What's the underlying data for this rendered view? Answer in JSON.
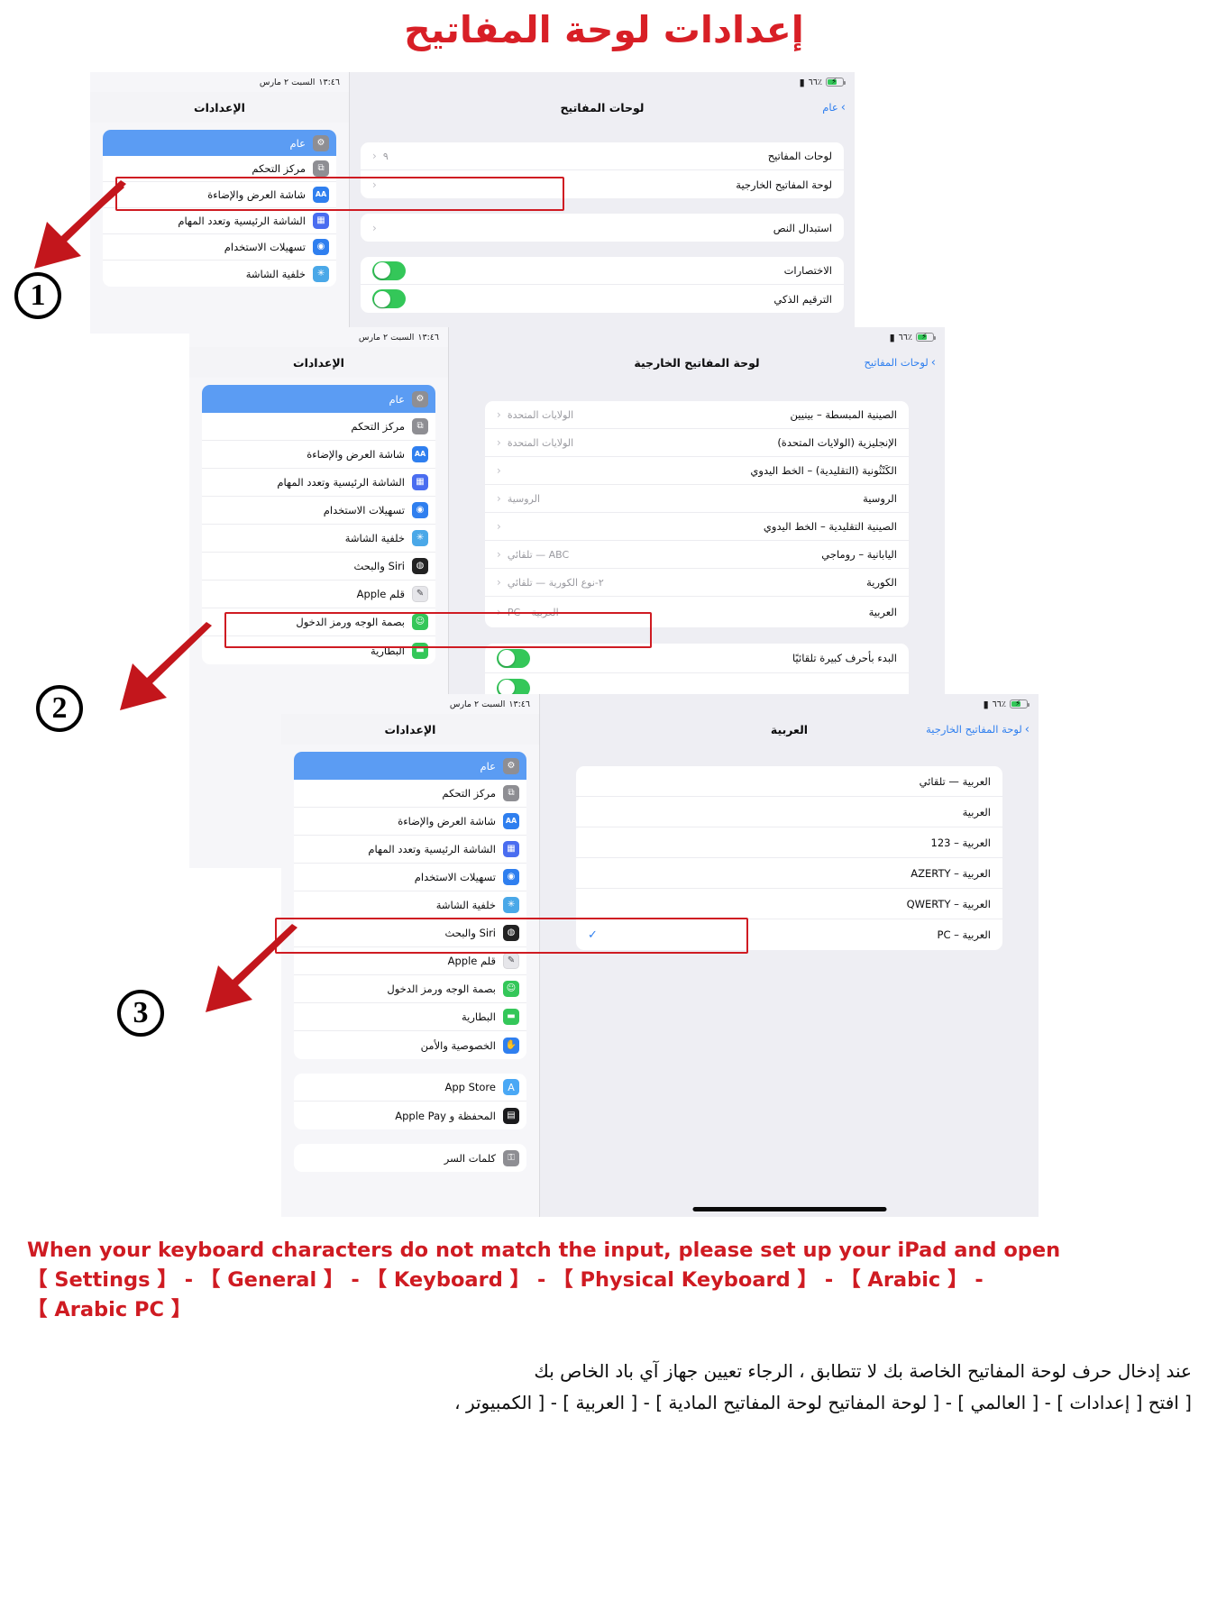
{
  "title": "إعدادات لوحة المفاتيح",
  "status_bar": {
    "time": "١٣:٤٦",
    "date": "السبت ٢ مارس",
    "battery": "٪٦٦"
  },
  "steps": {
    "one": "1",
    "two": "2",
    "three": "3"
  },
  "panel1": {
    "detail": {
      "nav_title": "لوحات المفاتيح",
      "back_label": "عام",
      "group1": [
        {
          "label": "لوحات المفاتيح",
          "value": "٩",
          "chevron": "‹"
        },
        {
          "label": "لوحة المفاتيح الخارجية",
          "value": "",
          "chevron": "‹"
        }
      ],
      "group2": [
        {
          "label": "استبدال النص",
          "value": "",
          "chevron": "‹"
        }
      ],
      "group3": [
        {
          "label": "الاختصارات",
          "toggle": true
        },
        {
          "label": "الترقيم الذكي",
          "toggle": true
        }
      ]
    },
    "settings": {
      "nav_title": "الإعدادات",
      "items": [
        {
          "label": "عام",
          "icon": "gear-icon",
          "glyph": "⚙",
          "color": "#8e8e93",
          "selected": true
        },
        {
          "label": "مركز التحكم",
          "icon": "control-center-icon",
          "glyph": "⧉",
          "color": "#8e8e93",
          "selected": false
        },
        {
          "label": "شاشة العرض والإضاءة",
          "icon": "display-brightness-icon",
          "glyph": "AA",
          "color": "#2f7fef",
          "selected": false
        },
        {
          "label": "الشاشة الرئيسية وتعدد المهام",
          "icon": "home-screen-icon",
          "glyph": "▦",
          "color": "#4a6df0",
          "selected": false
        },
        {
          "label": "تسهيلات الاستخدام",
          "icon": "accessibility-icon",
          "glyph": "◉",
          "color": "#2f7fef",
          "selected": false
        },
        {
          "label": "خلفية الشاشة",
          "icon": "wallpaper-icon",
          "glyph": "✳",
          "color": "#4aa8e8",
          "selected": false
        }
      ]
    }
  },
  "panel2": {
    "detail": {
      "nav_title": "لوحة المفاتيح الخارجية",
      "back_label": "لوحات المفاتيح",
      "group1": [
        {
          "label": "الصينية المبسطة – بينيين",
          "value": "الولايات المتحدة",
          "chevron": "‹"
        },
        {
          "label": "الإنجليزية (الولايات المتحدة)",
          "value": "الولايات المتحدة",
          "chevron": "‹"
        },
        {
          "label": "الكَنْثُونية (التقليدية) – الخط اليدوي",
          "value": "",
          "chevron": "‹"
        },
        {
          "label": "الروسية",
          "value": "الروسية",
          "chevron": "‹"
        },
        {
          "label": "الصينية التقليدية – الخط اليدوي",
          "value": "",
          "chevron": "‹"
        },
        {
          "label": "اليابانية – روماجي",
          "value": "ABC — تلقائي",
          "chevron": "‹"
        },
        {
          "label": "الكورية",
          "value": "٢-نوع الكورية — تلقائي",
          "chevron": "‹"
        },
        {
          "label": "العربية",
          "value": "العربية – PC",
          "chevron": "‹"
        }
      ],
      "group2": [
        {
          "label": "البدء بأحرف كبيرة تلقائيًا",
          "toggle": true
        },
        {
          "label": "",
          "toggle": true
        },
        {
          "label": "",
          "toggle": true
        },
        {
          "label": "",
          "toggle": true
        }
      ]
    },
    "settings": {
      "nav_title": "الإعدادات",
      "items": [
        {
          "label": "عام",
          "icon": "gear-icon",
          "glyph": "⚙",
          "color": "#8e8e93",
          "selected": true
        },
        {
          "label": "مركز التحكم",
          "icon": "control-center-icon",
          "glyph": "⧉",
          "color": "#8e8e93",
          "selected": false
        },
        {
          "label": "شاشة العرض والإضاءة",
          "icon": "display-brightness-icon",
          "glyph": "AA",
          "color": "#2f7fef",
          "selected": false
        },
        {
          "label": "الشاشة الرئيسية وتعدد المهام",
          "icon": "home-screen-icon",
          "glyph": "▦",
          "color": "#4a6df0",
          "selected": false
        },
        {
          "label": "تسهيلات الاستخدام",
          "icon": "accessibility-icon",
          "glyph": "◉",
          "color": "#2f7fef",
          "selected": false
        },
        {
          "label": "خلفية الشاشة",
          "icon": "wallpaper-icon",
          "glyph": "✳",
          "color": "#4aa8e8",
          "selected": false
        },
        {
          "label": "Siri والبحث",
          "icon": "siri-icon",
          "glyph": "◍",
          "color": "#222222",
          "selected": false
        },
        {
          "label": "قلم Apple",
          "icon": "apple-pencil-icon",
          "glyph": "✎",
          "color": "#d9d9de",
          "selected": false
        },
        {
          "label": "بصمة الوجه ورمز الدخول",
          "icon": "face-id-icon",
          "glyph": "☺",
          "color": "#34c759",
          "selected": false
        },
        {
          "label": "البطارية",
          "icon": "battery-icon",
          "glyph": "▬",
          "color": "#34c759",
          "selected": false
        }
      ]
    }
  },
  "panel3": {
    "detail": {
      "nav_title": "العربية",
      "back_label": "لوحة المفاتيح الخارجية",
      "options": [
        {
          "label": "العربية — تلقائي",
          "selected": false
        },
        {
          "label": "العربية",
          "selected": false
        },
        {
          "label": "العربية – 123",
          "selected": false
        },
        {
          "label": "العربية – AZERTY",
          "selected": false
        },
        {
          "label": "العربية – QWERTY",
          "selected": false
        },
        {
          "label": "العربية – PC",
          "selected": true
        }
      ],
      "check_glyph": "✓"
    },
    "settings": {
      "nav_title": "الإعدادات",
      "items": [
        {
          "label": "عام",
          "icon": "gear-icon",
          "glyph": "⚙",
          "color": "#8e8e93",
          "selected": true
        },
        {
          "label": "مركز التحكم",
          "icon": "control-center-icon",
          "glyph": "⧉",
          "color": "#8e8e93",
          "selected": false
        },
        {
          "label": "شاشة العرض والإضاءة",
          "icon": "display-brightness-icon",
          "glyph": "AA",
          "color": "#2f7fef",
          "selected": false
        },
        {
          "label": "الشاشة الرئيسية وتعدد المهام",
          "icon": "home-screen-icon",
          "glyph": "▦",
          "color": "#4a6df0",
          "selected": false
        },
        {
          "label": "تسهيلات الاستخدام",
          "icon": "accessibility-icon",
          "glyph": "◉",
          "color": "#2f7fef",
          "selected": false
        },
        {
          "label": "خلفية الشاشة",
          "icon": "wallpaper-icon",
          "glyph": "✳",
          "color": "#4aa8e8",
          "selected": false
        },
        {
          "label": "Siri والبحث",
          "icon": "siri-icon",
          "glyph": "◍",
          "color": "#222222",
          "selected": false
        },
        {
          "label": "قلم Apple",
          "icon": "apple-pencil-icon",
          "glyph": "✎",
          "color": "#d9d9de",
          "selected": false
        },
        {
          "label": "بصمة الوجه ورمز الدخول",
          "icon": "face-id-icon",
          "glyph": "☺",
          "color": "#34c759",
          "selected": false
        },
        {
          "label": "البطارية",
          "icon": "battery-icon",
          "glyph": "▬",
          "color": "#34c759",
          "selected": false
        },
        {
          "label": "الخصوصية والأمن",
          "icon": "privacy-hand-icon",
          "glyph": "✋",
          "color": "#2f7fef",
          "selected": false
        }
      ],
      "items2": [
        {
          "label": "App Store",
          "icon": "app-store-icon",
          "glyph": "A",
          "color": "#4aa8f5",
          "selected": false
        },
        {
          "label": "المحفظة و Apple Pay",
          "icon": "wallet-icon",
          "glyph": "▤",
          "color": "#1b1b1d",
          "selected": false
        }
      ],
      "items3": [
        {
          "label": "كلمات السر",
          "icon": "passwords-key-icon",
          "glyph": "⚿",
          "color": "#8e8e93",
          "selected": false
        }
      ]
    }
  },
  "caption_en": {
    "line1": "When your keyboard characters do not match the input, please set up your iPad and open",
    "line2": "【 Settings 】 - 【 General 】 - 【 Keyboard 】 - 【 Physical Keyboard 】 - 【 Arabic 】 -",
    "line3": "【 Arabic PC 】"
  },
  "caption_ar": {
    "line1": "عند إدخال حرف لوحة المفاتيح الخاصة بك لا تتطابق ، الرجاء تعيين جهاز آي باد الخاص بك",
    "line2": "[ افتح [ إعدادات ] - [ العالمي ] - [ لوحة المفاتيح لوحة المفاتيح المادية ] - [ العربية ] - [ الكمبيوتر ،"
  }
}
